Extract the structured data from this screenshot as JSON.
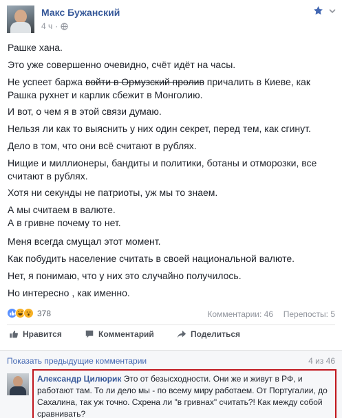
{
  "post": {
    "author": "Макс Бужанский",
    "time": "4 ч",
    "paragraphs": [
      {
        "text": "Рашке хана."
      },
      {
        "text": "Это уже совершенно очевидно, счёт идёт на часы."
      },
      {
        "pre": "Не успеет баржа ",
        "strike": "войти в Ормузский пролив",
        "post": " причалить в Киеве, как Рашка рухнет и карлик сбежит в Монголию."
      },
      {
        "text": "И вот, о чем я в этой связи думаю."
      },
      {
        "text": "Нельзя ли как то выяснить у них один секрет, перед тем, как сгинут."
      },
      {
        "text": "Дело в том, что они всё считают в рублях."
      },
      {
        "text": "Нищие и миллионеры, бандиты и политики, ботаны и отморозки, все считают в рублях."
      },
      {
        "text": "Хотя ни секунды не патриоты, уж мы то знаем."
      },
      {
        "text": "А мы считаем в валюте.\nА в гривне почему то нет."
      },
      {
        "text": "Меня всегда смущал этот момент."
      },
      {
        "text": "Как побудить население считать в своей национальной валюте."
      },
      {
        "text": "Нет, я понимаю, что у них это случайно получилось."
      },
      {
        "text": "Но интересно , как именно."
      }
    ],
    "reaction_count": "378",
    "comments_count": "Комментарии: 46",
    "shares_count": "Перепосты: 5"
  },
  "actions": {
    "like": "Нравится",
    "comment": "Комментарий",
    "share": "Поделиться"
  },
  "comments": {
    "show_previous": "Показать предыдущие комментарии",
    "pager": "4 из 46",
    "first": {
      "author": "Александр Цилюрик",
      "text": "Это от безысходности. Они же и живут в РФ, и работают там. То ли дело мы - по всему миру работаем. От Португалии, до Сахалина, так уж точно. Схрена ли \"в гривнах\" считать?! Как между собой сравнивать?"
    }
  },
  "colors": {
    "link": "#365899",
    "highlight_border": "#c0161d",
    "like_blue": "#5890ff"
  }
}
